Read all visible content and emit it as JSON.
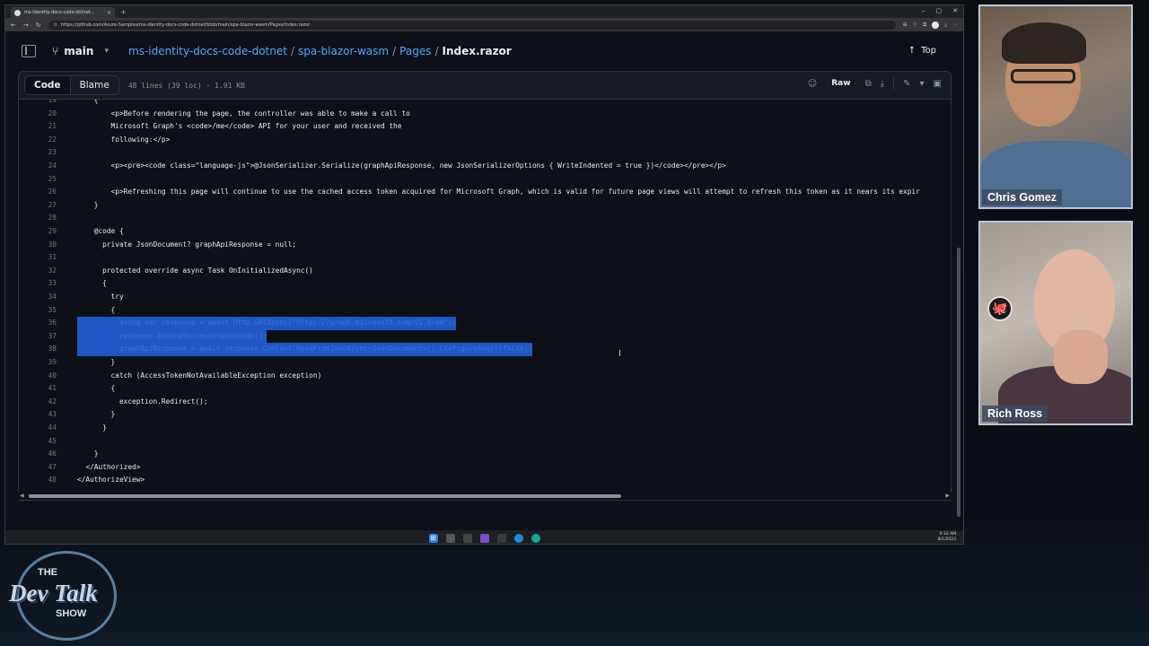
{
  "browser": {
    "tab_title": "ms-identity-docs-code-dotnet...",
    "url": "https://github.com/Azure-Samples/ms-identity-docs-code-dotnet/blob/main/spa-blazor-wasm/Pages/Index.razor"
  },
  "github": {
    "branch": "main",
    "breadcrumb": {
      "repo": "ms-identity-docs-code-dotnet",
      "folder1": "spa-blazor-wasm",
      "folder2": "Pages",
      "file": "Index.razor",
      "sep": "/"
    },
    "top_label": "Top",
    "tabs": {
      "code": "Code",
      "blame": "Blame"
    },
    "file_meta": "48 lines (39 loc) · 1.91 KB",
    "raw_label": "Raw"
  },
  "code_lines": [
    {
      "n": "19",
      "t": "    {"
    },
    {
      "n": "20",
      "t": "        <p>Before rendering the page, the controller was able to make a call to"
    },
    {
      "n": "21",
      "t": "        Microsoft Graph's <code>/me</code> API for your user and received the"
    },
    {
      "n": "22",
      "t": "        following:</p>"
    },
    {
      "n": "23",
      "t": ""
    },
    {
      "n": "24",
      "t": "        <p><pre><code class=\"language-js\">@JsonSerializer.Serialize(graphApiResponse, new JsonSerializerOptions { WriteIndented = true })</code></pre></p>"
    },
    {
      "n": "25",
      "t": ""
    },
    {
      "n": "26",
      "t": "        <p>Refreshing this page will continue to use the cached access token acquired for Microsoft Graph, which is valid for future page views will attempt to refresh this token as it nears its expir"
    },
    {
      "n": "27",
      "t": "    }"
    },
    {
      "n": "28",
      "t": ""
    },
    {
      "n": "29",
      "t": "    @code {"
    },
    {
      "n": "30",
      "t": "      private JsonDocument? graphApiResponse = null;"
    },
    {
      "n": "31",
      "t": ""
    },
    {
      "n": "32",
      "t": "      protected override async Task OnInitializedAsync()"
    },
    {
      "n": "33",
      "t": "      {"
    },
    {
      "n": "34",
      "t": "        try"
    },
    {
      "n": "35",
      "t": "        {"
    },
    {
      "n": "36",
      "t": "          using var response = await Http.GetAsync(\"https://graph.microsoft.com/v1.0/me\");"
    },
    {
      "n": "37",
      "t": "          response.EnsureSuccessStatusCode();"
    },
    {
      "n": "38",
      "t": "          graphApiResponse = await response.Content.ReadFromJsonAsync<JsonDocument>().ConfigureAwait(false);"
    },
    {
      "n": "39",
      "t": "        }"
    },
    {
      "n": "40",
      "t": "        catch (AccessTokenNotAvailableException exception)"
    },
    {
      "n": "41",
      "t": "        {"
    },
    {
      "n": "42",
      "t": "          exception.Redirect();"
    },
    {
      "n": "43",
      "t": "        }"
    },
    {
      "n": "44",
      "t": "      }"
    },
    {
      "n": "45",
      "t": ""
    },
    {
      "n": "46",
      "t": "    }"
    },
    {
      "n": "47",
      "t": "  </Authorized>"
    },
    {
      "n": "48",
      "t": "</AuthorizeView>"
    }
  ],
  "selected_lines": [
    "36",
    "37",
    "38"
  ],
  "taskbar": {
    "time": "9:33 AM",
    "date": "8/1/2023"
  },
  "webcams": [
    {
      "name": "Chris Gomez"
    },
    {
      "name": "Rich Ross"
    }
  ],
  "logo": {
    "the": "THE",
    "main": "Dev Talk",
    "show": "SHOW"
  }
}
